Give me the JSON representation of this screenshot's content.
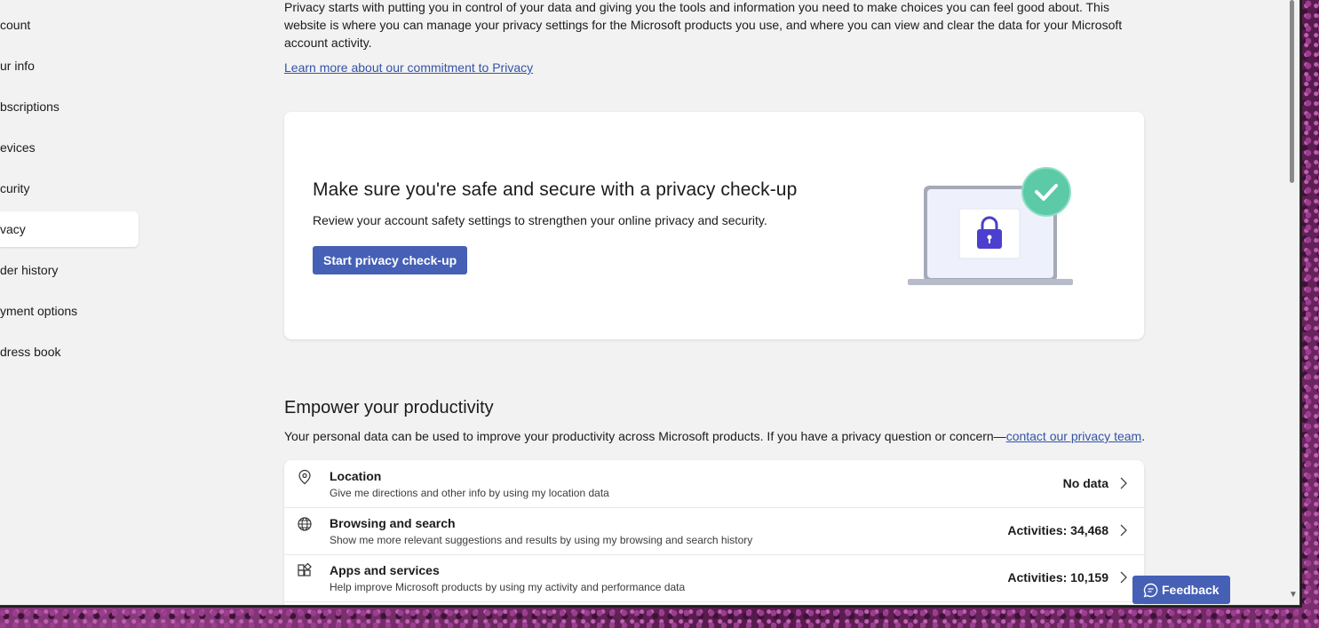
{
  "sidebar": {
    "items": [
      {
        "label": "Account",
        "visible": "count"
      },
      {
        "label": "Your info",
        "visible": "ur info"
      },
      {
        "label": "Subscriptions",
        "visible": "bscriptions"
      },
      {
        "label": "Devices",
        "visible": "evices"
      },
      {
        "label": "Security",
        "visible": "curity"
      },
      {
        "label": "Privacy",
        "visible": "vacy",
        "active": true
      },
      {
        "label": "Order history",
        "visible": "der history"
      },
      {
        "label": "Payment options",
        "visible": "yment options"
      },
      {
        "label": "Address book",
        "visible": "dress book"
      }
    ]
  },
  "intro": {
    "text": "Privacy starts with putting you in control of your data and giving you the tools and information you need to make choices you can feel good about. This website is where you can manage your privacy settings for the Microsoft products you use, and where you can view and clear the data for your Microsoft account activity.",
    "learn_more": "Learn more about our commitment to Privacy"
  },
  "checkup_card": {
    "title": "Make sure you're safe and secure with a privacy check-up",
    "description": "Review your account safety settings to strengthen your online privacy and security.",
    "button": "Start privacy check-up",
    "illustration": "laptop-lock-check-icon"
  },
  "productivity": {
    "title": "Empower your productivity",
    "description_prefix": "Your personal data can be used to improve your productivity across Microsoft products. If you have a privacy question or concern—",
    "contact_link": "contact our privacy team",
    "description_suffix": ".",
    "rows": [
      {
        "icon": "location-pin-icon",
        "title": "Location",
        "subtitle": "Give me directions and other info by using my location data",
        "status": "No data"
      },
      {
        "icon": "globe-icon",
        "title": "Browsing and search",
        "subtitle": "Show me more relevant suggestions and results by using my browsing and search history",
        "status": "Activities: 34,468"
      },
      {
        "icon": "apps-icon",
        "title": "Apps and services",
        "subtitle": "Help improve Microsoft products by using my activity and performance data",
        "status": "Activities: 10,159"
      }
    ]
  },
  "feedback": {
    "label": "Feedback"
  },
  "colors": {
    "accent": "#4560b5",
    "link": "#3453a8",
    "check": "#5cc9a7"
  }
}
